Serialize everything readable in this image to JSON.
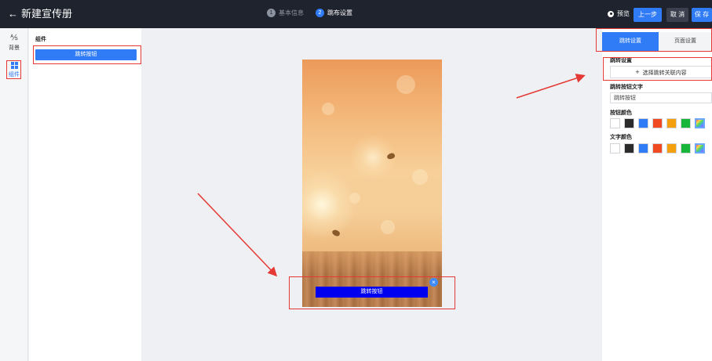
{
  "header": {
    "back_label": "新建宣传册",
    "steps": [
      {
        "num": "1",
        "label": "基本信息",
        "active": false
      },
      {
        "num": "2",
        "label": "跳布设置",
        "active": true
      }
    ],
    "preview_label": "预览",
    "prev_label": "上一步",
    "cancel_label": "取 消",
    "save_label": "保 存"
  },
  "rail": {
    "items": [
      {
        "icon": "background-icon",
        "label": "背景"
      },
      {
        "icon": "components-grid-icon",
        "label": "组件"
      }
    ]
  },
  "components": {
    "title": "组件",
    "button_label": "跳转按钮"
  },
  "canvas": {
    "button_label": "跳转按钮",
    "close_glyph": "×"
  },
  "right": {
    "tabs": [
      "跳转设置",
      "页面设置"
    ],
    "jump_section": "跳转设置",
    "select_label": "选择跳转关联内容",
    "select_plus": "+",
    "text_section": "跳转按钮文字",
    "text_value": "跳转按钮",
    "button_color_section": "按钮颜色",
    "text_color_section": "文字颜色",
    "colors": [
      "#ffffff",
      "#2b2b2b",
      "#2f7cf6",
      "#f04a23",
      "#f5a00f",
      "#17b53a",
      "rainbow"
    ]
  },
  "accent": "#2f7cf6",
  "annotation_color": "#e53935"
}
